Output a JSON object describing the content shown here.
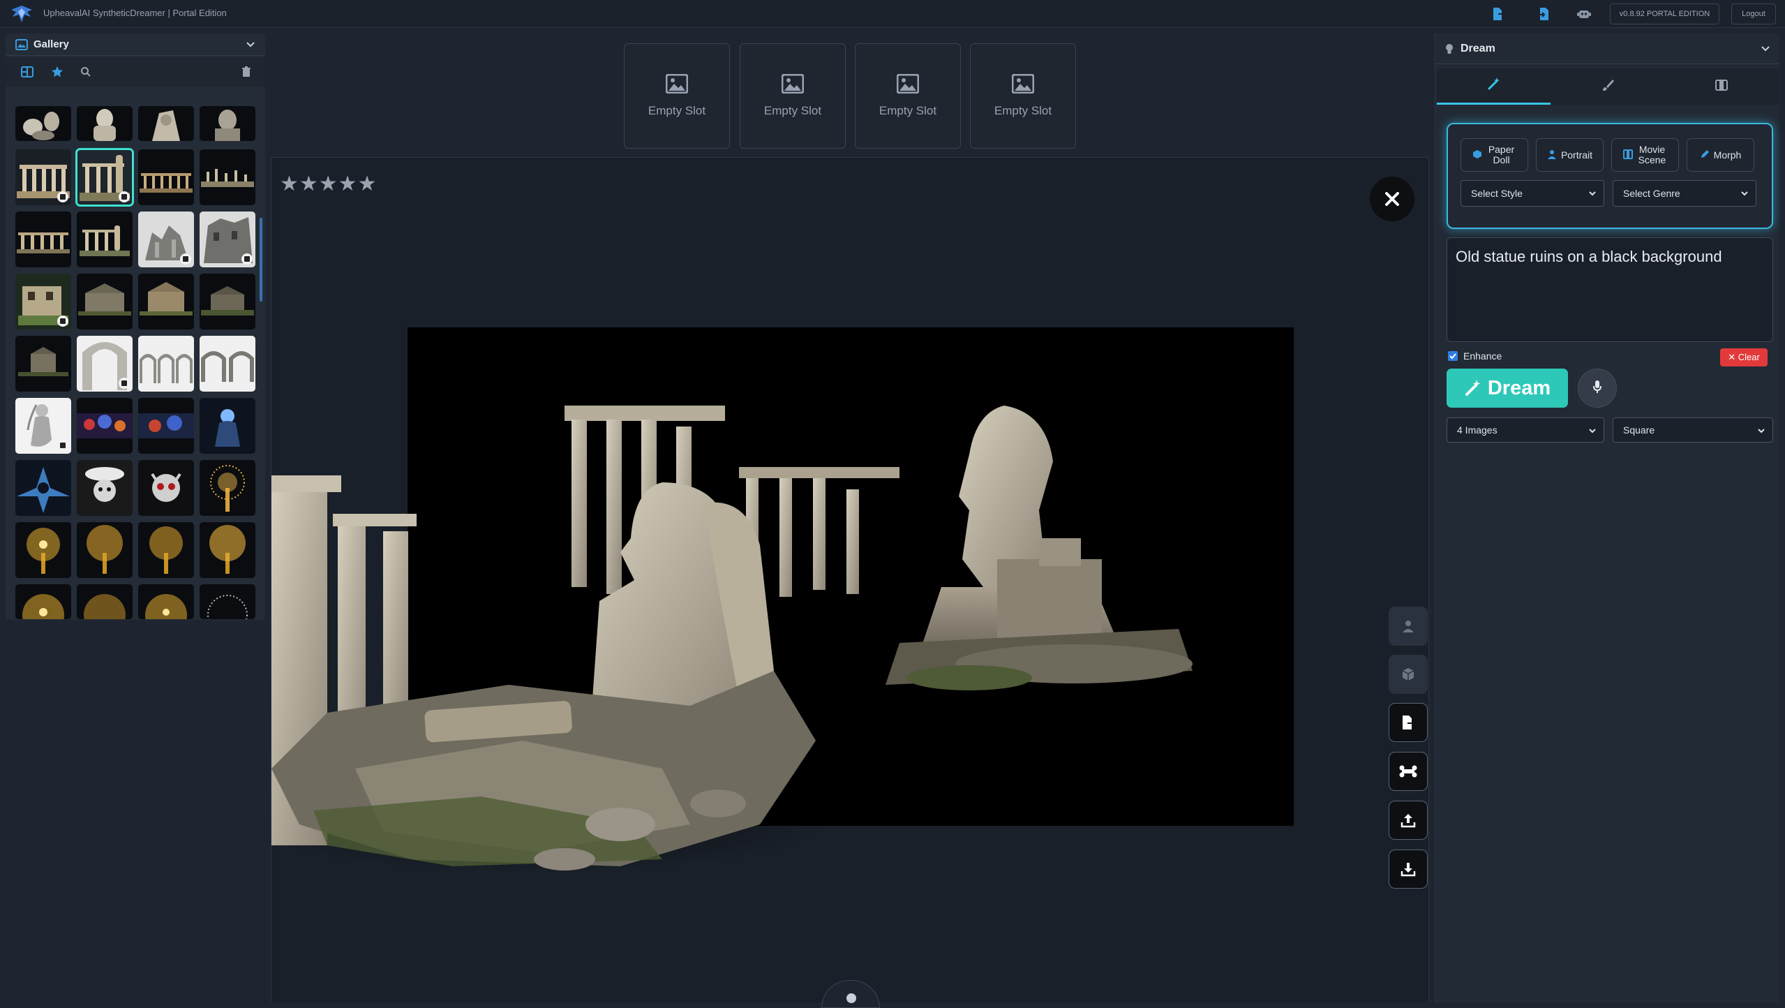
{
  "app": {
    "title": "UpheavalAI SyntheticDreamer | Portal Edition",
    "version_label": "v0.8.92 PORTAL EDITION",
    "logout_label": "Logout",
    "accent": "#2ec8b8",
    "highlight": "#3ab8e0"
  },
  "gallery": {
    "title": "Gallery",
    "tools": [
      "grid-icon",
      "star-icon",
      "search-icon",
      "trash-icon"
    ]
  },
  "slots": [
    {
      "label": "Empty Slot"
    },
    {
      "label": "Empty Slot"
    },
    {
      "label": "Empty Slot"
    },
    {
      "label": "Empty Slot"
    }
  ],
  "viewer": {
    "rating": "★★★★★"
  },
  "dream": {
    "title": "Dream",
    "tabs": [
      "magic-wand-icon",
      "brush-icon",
      "film-icon"
    ],
    "modes": [
      {
        "label": "Paper Doll",
        "icon": "cube-icon"
      },
      {
        "label": "Portrait",
        "icon": "person-icon"
      },
      {
        "label": "Movie Scene",
        "icon": "film-icon"
      },
      {
        "label": "Morph",
        "icon": "pencil-icon"
      }
    ],
    "style_select": "Select Style",
    "genre_select": "Select Genre",
    "prompt": "Old statue ruins on a black background",
    "enhance_label": "Enhance",
    "enhance_checked": true,
    "clear_label": "✕ Clear",
    "dream_label": "Dream",
    "images_select": "4 Images",
    "aspect_select": "Square"
  }
}
